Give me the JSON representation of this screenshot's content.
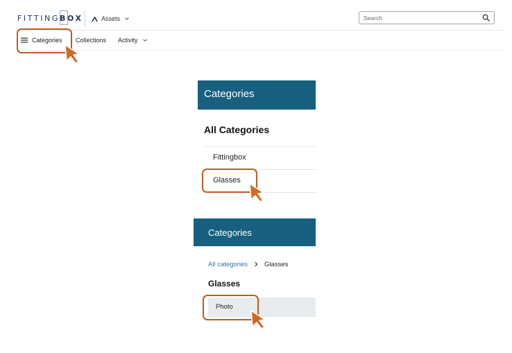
{
  "header": {
    "logo_light": "FITTING",
    "logo_bold": "BOX",
    "assets_label": "Assets",
    "search_placeholder": "Search"
  },
  "nav": {
    "categories_label": "Categories",
    "collections_label": "Collections",
    "activity_label": "Activity"
  },
  "panel1": {
    "title": "Categories",
    "heading": "All Categories",
    "items": [
      "Fittingbox",
      "Glasses"
    ]
  },
  "panel2": {
    "title": "Categories",
    "breadcrumb_link": "All categories",
    "breadcrumb_current": "Glasses",
    "heading": "Glasses",
    "items": [
      "Photo"
    ]
  },
  "icons": {
    "menu": "hamburger-menu-icon",
    "search": "magnifier-search-icon",
    "assets": "caret-up-arrow-icon",
    "dropdown": "chevron-down-icon",
    "breadcrumb_separator": "chevron-right-icon",
    "pointer": "pointer-cursor-icon"
  },
  "colors": {
    "brand_navy": "#1d3557",
    "panel_header": "#17607f",
    "highlight": "#c2581e",
    "link": "#2f6fb0",
    "row_background": "#e9ecee"
  }
}
